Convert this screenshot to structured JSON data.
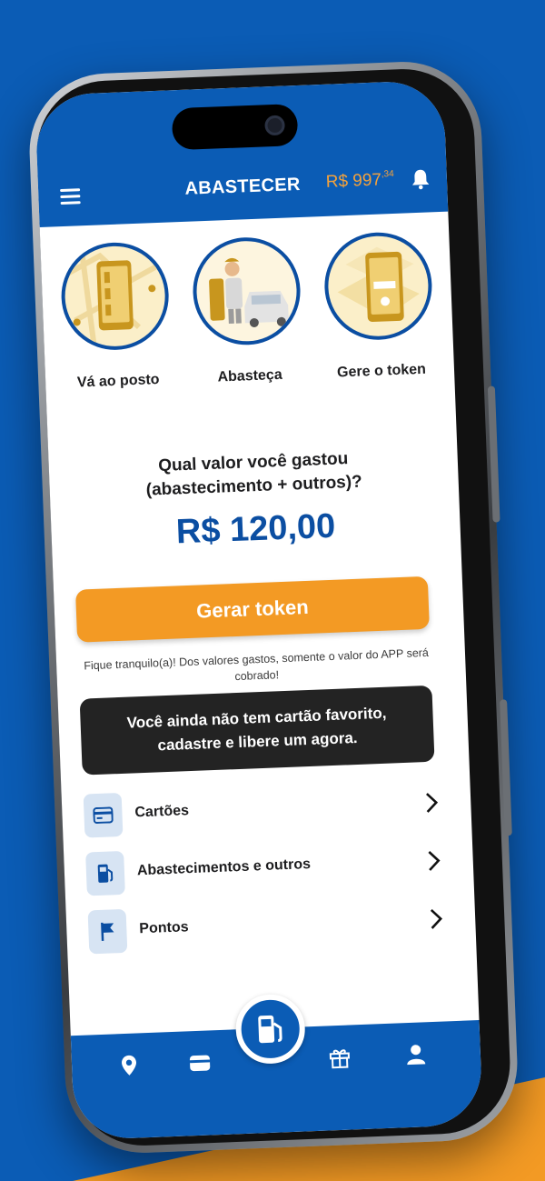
{
  "header": {
    "title": "ABASTECER",
    "balance_main": "R$ 997",
    "balance_cents": ",34"
  },
  "steps": [
    {
      "label": "Vá ao posto",
      "icon": "map-phone-icon"
    },
    {
      "label": "Abasteça",
      "icon": "attendant-car-icon"
    },
    {
      "label": "Gere o token",
      "icon": "token-phone-icon"
    }
  ],
  "question": {
    "line1": "Qual valor você gastou",
    "line2": "(abastecimento + outros)?"
  },
  "amount": "R$ 120,00",
  "token_button": "Gerar token",
  "hint": "Fique tranquilo(a)! Dos valores gastos, somente o valor do APP será cobrado!",
  "favorite_notice": {
    "line1": "Você ainda não tem cartão favorito,",
    "line2": "cadastre e libere um agora."
  },
  "menu": [
    {
      "label": "Cartões",
      "icon": "card-icon"
    },
    {
      "label": "Abastecimentos e outros",
      "icon": "fuel-pump-icon"
    },
    {
      "label": "Pontos",
      "icon": "flag-icon"
    }
  ],
  "bottom_nav": [
    "location-icon",
    "wallet-icon",
    "fuel-pump-icon",
    "gift-icon",
    "user-icon"
  ],
  "colors": {
    "brand_blue": "#0b5cb5",
    "accent_orange": "#f39a24",
    "dark_box": "#232323",
    "amount_blue": "#0b4ea2"
  }
}
